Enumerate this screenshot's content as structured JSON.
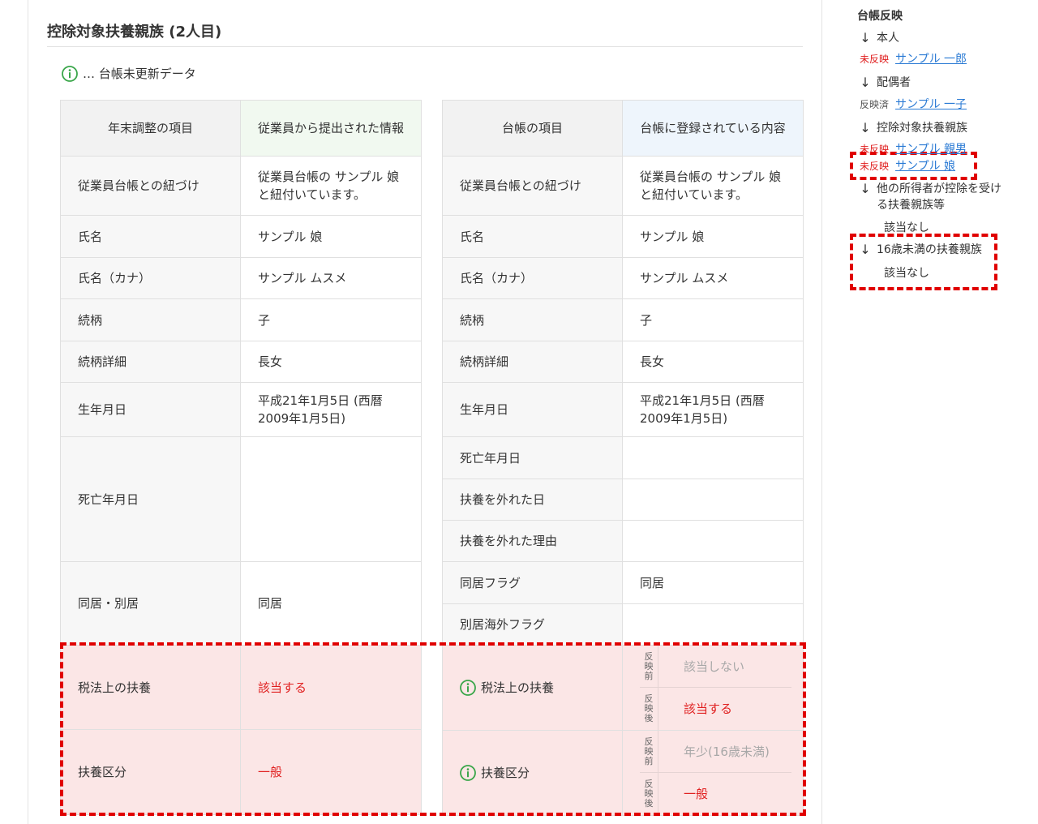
{
  "page": {
    "title": "控除対象扶養親族 (2人目)"
  },
  "legend": {
    "text": "… 台帳未更新データ"
  },
  "left_table": {
    "headers": [
      "年末調整の項目",
      "従業員から提出された情報"
    ],
    "rows": {
      "link": {
        "label": "従業員台帳との紐づけ",
        "value": "従業員台帳の サンプル 娘 と紐付いています。"
      },
      "name": {
        "label": "氏名",
        "value": "サンプル 娘"
      },
      "kana": {
        "label": "氏名（カナ）",
        "value": "サンプル ムスメ"
      },
      "relation": {
        "label": "続柄",
        "value": "子"
      },
      "relation_detail": {
        "label": "続柄詳細",
        "value": "長女"
      },
      "birthday": {
        "label": "生年月日",
        "value": "平成21年1月5日 (西暦2009年1月5日)"
      },
      "death": {
        "label": "死亡年月日",
        "value": ""
      },
      "living": {
        "label": "同居・別居",
        "value": "同居"
      },
      "tax_dependent": {
        "label": "税法上の扶養",
        "value": "該当する"
      },
      "dependent_type": {
        "label": "扶養区分",
        "value": "一般"
      }
    }
  },
  "right_table": {
    "headers": [
      "台帳の項目",
      "台帳に登録されている内容"
    ],
    "rows": {
      "link": {
        "label": "従業員台帳との紐づけ",
        "value": "従業員台帳の サンプル 娘 と紐付いています。"
      },
      "name": {
        "label": "氏名",
        "value": "サンプル 娘"
      },
      "kana": {
        "label": "氏名（カナ）",
        "value": "サンプル ムスメ"
      },
      "relation": {
        "label": "続柄",
        "value": "子"
      },
      "relation_detail": {
        "label": "続柄詳細",
        "value": "長女"
      },
      "birthday": {
        "label": "生年月日",
        "value": "平成21年1月5日 (西暦2009年1月5日)"
      },
      "death": {
        "label": "死亡年月日",
        "value": ""
      },
      "removed_date": {
        "label": "扶養を外れた日",
        "value": ""
      },
      "removed_reason": {
        "label": "扶養を外れた理由",
        "value": ""
      },
      "cohabit_flag": {
        "label": "同居フラグ",
        "value": "同居"
      },
      "overseas_flag": {
        "label": "別居海外フラグ",
        "value": ""
      },
      "tax_dependent": {
        "label": "税法上の扶養",
        "before_tag": [
          "反",
          "映",
          "前"
        ],
        "before": "該当しない",
        "after_tag": [
          "反",
          "映",
          "後"
        ],
        "after": "該当する"
      },
      "dependent_type": {
        "label": "扶養区分",
        "before_tag": [
          "反",
          "映",
          "前"
        ],
        "before": "年少(16歳未満)",
        "after_tag": [
          "反",
          "映",
          "後"
        ],
        "after": "一般"
      }
    }
  },
  "sidebar": {
    "title": "台帳反映",
    "sections": {
      "self": {
        "title": "本人",
        "status": "未反映",
        "link": "サンプル 一郎"
      },
      "spouse": {
        "title": "配偶者",
        "status": "反映済",
        "link": "サンプル 一子"
      },
      "dependents": {
        "title": "控除対象扶養親族",
        "items": [
          {
            "status": "未反映",
            "link": "サンプル 親男"
          },
          {
            "status": "未反映",
            "link": "サンプル 娘"
          }
        ]
      },
      "other_income": {
        "title_line1": "他の所得者が控除を受け",
        "title_line2": "る扶養親族等",
        "none": "該当なし"
      },
      "under16": {
        "title": "16歳未満の扶養親族",
        "none": "該当なし"
      }
    }
  },
  "colors": {
    "accent_red": "#e02020",
    "link_blue": "#2a7ad4",
    "highlight_bg": "#fbe6e6",
    "info_green": "#3aa64a"
  }
}
